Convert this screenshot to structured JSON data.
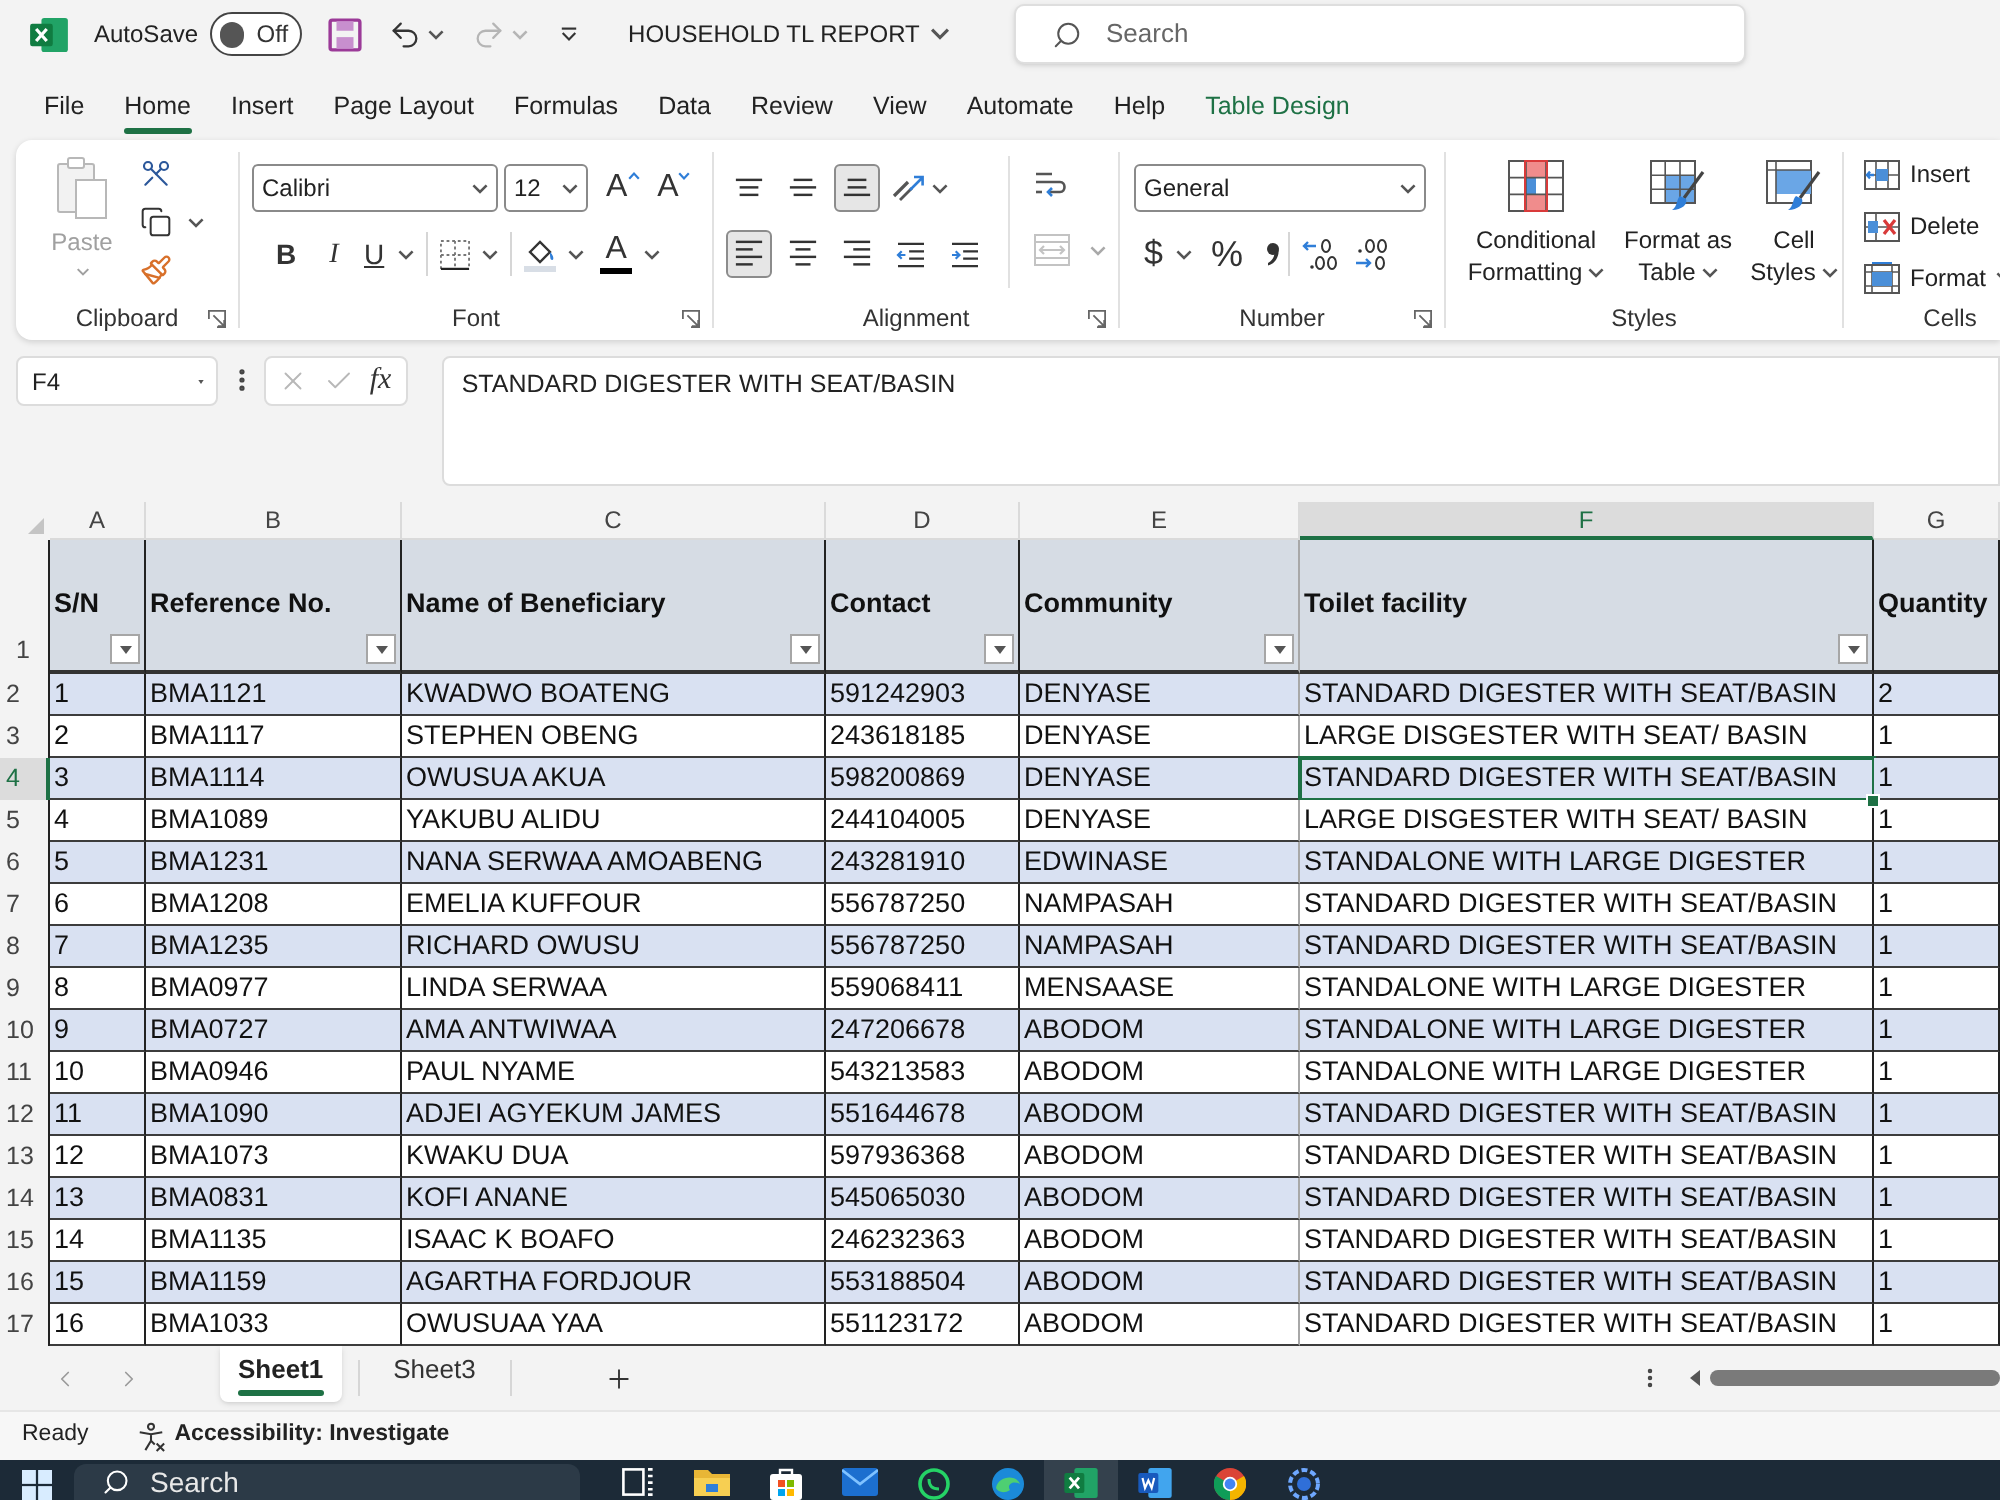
{
  "title_bar": {
    "autosave": {
      "label": "AutoSave",
      "on": false,
      "state": "Off"
    },
    "redo": {
      "disabled": true
    },
    "document_title": "HOUSEHOLD TL REPORT",
    "search": {
      "placeholder": "Search"
    }
  },
  "ribbon_tabs": [
    {
      "label": "File",
      "selected": false,
      "kind": "standard"
    },
    {
      "label": "Home",
      "selected": true,
      "kind": "standard"
    },
    {
      "label": "Insert",
      "selected": false,
      "kind": "standard"
    },
    {
      "label": "Page Layout",
      "selected": false,
      "kind": "standard"
    },
    {
      "label": "Formulas",
      "selected": false,
      "kind": "standard"
    },
    {
      "label": "Data",
      "selected": false,
      "kind": "standard"
    },
    {
      "label": "Review",
      "selected": false,
      "kind": "standard"
    },
    {
      "label": "View",
      "selected": false,
      "kind": "standard"
    },
    {
      "label": "Automate",
      "selected": false,
      "kind": "standard"
    },
    {
      "label": "Help",
      "selected": false,
      "kind": "standard"
    },
    {
      "label": "Table Design",
      "selected": false,
      "kind": "contextual"
    }
  ],
  "ribbon": {
    "clipboard": {
      "label": "Clipboard",
      "paste": {
        "label": "Paste",
        "disabled": true
      }
    },
    "font": {
      "label": "Font",
      "font_name": "Calibri",
      "font_size": "12",
      "size_buttons": [
        {
          "kind": "grow",
          "label": "A"
        },
        {
          "kind": "shrink",
          "label": "A"
        }
      ],
      "style_buttons": [
        {
          "kind": "bold",
          "label": "B"
        },
        {
          "kind": "italic",
          "label": "I"
        },
        {
          "kind": "underline",
          "label": "U"
        }
      ],
      "font_color": {
        "label": "A"
      }
    },
    "alignment": {
      "label": "Alignment",
      "vertical": [
        {
          "kind": "top",
          "selected": false
        },
        {
          "kind": "middle",
          "selected": false
        },
        {
          "kind": "bottom",
          "selected": true
        }
      ],
      "horizontal": [
        {
          "kind": "left",
          "selected": true
        },
        {
          "kind": "center",
          "selected": false
        },
        {
          "kind": "right",
          "selected": false
        }
      ],
      "merge": {
        "disabled": true
      }
    },
    "number": {
      "label": "Number",
      "format": "General",
      "currency": "$",
      "percent": "%"
    },
    "styles": {
      "label": "Styles",
      "buttons": [
        {
          "kind": "conditional",
          "lines": [
            "Conditional",
            "Formatting"
          ]
        },
        {
          "kind": "table",
          "lines": [
            "Format as",
            "Table"
          ]
        },
        {
          "kind": "cell",
          "lines": [
            "Cell",
            "Styles"
          ]
        }
      ]
    },
    "cells": {
      "label": "Cells",
      "buttons": [
        {
          "kind": "insert",
          "label": "Insert"
        },
        {
          "kind": "delete",
          "label": "Delete"
        },
        {
          "kind": "format",
          "label": "Format"
        }
      ]
    }
  },
  "formula_bar": {
    "name_box": "F4",
    "edit_buttons": [
      {
        "kind": "cancel",
        "disabled": true
      },
      {
        "kind": "enter",
        "disabled": true
      }
    ],
    "function_label": "fx",
    "formula": "STANDARD DIGESTER WITH SEAT/BASIN"
  },
  "sheet": {
    "columns": [
      {
        "letter": "A",
        "heading": "S/N",
        "selected": false
      },
      {
        "letter": "B",
        "heading": "Reference No.",
        "selected": false
      },
      {
        "letter": "C",
        "heading": "Name of Beneficiary",
        "selected": false
      },
      {
        "letter": "D",
        "heading": "Contact",
        "selected": false
      },
      {
        "letter": "E",
        "heading": "Community",
        "selected": false
      },
      {
        "letter": "F",
        "heading": "Toilet facility",
        "selected": true
      },
      {
        "letter": "G",
        "heading": "Quantity",
        "selected": false
      }
    ],
    "header_row_number": "1",
    "rows": [
      {
        "number": "2",
        "selected": false,
        "cells": [
          "1",
          "BMA1121",
          "KWADWO BOATENG",
          "591242903",
          "DENYASE",
          "STANDARD DIGESTER WITH SEAT/BASIN",
          "2"
        ]
      },
      {
        "number": "3",
        "selected": false,
        "cells": [
          "2",
          "BMA1117",
          "STEPHEN OBENG",
          "243618185",
          "DENYASE",
          "LARGE DISGESTER WITH SEAT/ BASIN",
          "1"
        ]
      },
      {
        "number": "4",
        "selected": true,
        "cells": [
          "3",
          "BMA1114",
          "OWUSUA AKUA",
          "598200869",
          "DENYASE",
          "STANDARD DIGESTER WITH SEAT/BASIN",
          "1"
        ]
      },
      {
        "number": "5",
        "selected": false,
        "cells": [
          "4",
          "BMA1089",
          "YAKUBU ALIDU",
          "244104005",
          "DENYASE",
          "LARGE DISGESTER WITH SEAT/ BASIN",
          "1"
        ]
      },
      {
        "number": "6",
        "selected": false,
        "cells": [
          "5",
          "BMA1231",
          "NANA SERWAA AMOABENG",
          "243281910",
          "EDWINASE",
          "STANDALONE WITH LARGE DIGESTER",
          "1"
        ]
      },
      {
        "number": "7",
        "selected": false,
        "cells": [
          "6",
          "BMA1208",
          "EMELIA KUFFOUR",
          "556787250",
          "NAMPASAH",
          "STANDARD DIGESTER WITH SEAT/BASIN",
          "1"
        ]
      },
      {
        "number": "8",
        "selected": false,
        "cells": [
          "7",
          "BMA1235",
          "RICHARD OWUSU",
          "556787250",
          "NAMPASAH",
          "STANDARD DIGESTER WITH SEAT/BASIN",
          "1"
        ]
      },
      {
        "number": "9",
        "selected": false,
        "cells": [
          "8",
          "BMA0977",
          "LINDA SERWAA",
          "559068411",
          "MENSAASE",
          "STANDALONE WITH LARGE DIGESTER",
          "1"
        ]
      },
      {
        "number": "10",
        "selected": false,
        "cells": [
          "9",
          "BMA0727",
          "AMA ANTWIWAA",
          "247206678",
          "ABODOM",
          "STANDALONE WITH LARGE DIGESTER",
          "1"
        ]
      },
      {
        "number": "11",
        "selected": false,
        "cells": [
          "10",
          "BMA0946",
          "PAUL NYAME",
          "543213583",
          "ABODOM",
          "STANDALONE WITH LARGE DIGESTER",
          "1"
        ]
      },
      {
        "number": "12",
        "selected": false,
        "cells": [
          "11",
          "BMA1090",
          "ADJEI AGYEKUM JAMES",
          "551644678",
          "ABODOM",
          "STANDARD DIGESTER WITH SEAT/BASIN",
          "1"
        ]
      },
      {
        "number": "13",
        "selected": false,
        "cells": [
          "12",
          "BMA1073",
          "KWAKU DUA",
          "597936368",
          "ABODOM",
          "STANDARD DIGESTER WITH SEAT/BASIN",
          "1"
        ]
      },
      {
        "number": "14",
        "selected": false,
        "cells": [
          "13",
          "BMA0831",
          "KOFI ANANE",
          "545065030",
          "ABODOM",
          "STANDARD DIGESTER WITH SEAT/BASIN",
          "1"
        ]
      },
      {
        "number": "15",
        "selected": false,
        "cells": [
          "14",
          "BMA1135",
          "ISAAC K BOAFO",
          "246232363",
          "ABODOM",
          "STANDARD DIGESTER WITH SEAT/BASIN",
          "1"
        ]
      },
      {
        "number": "16",
        "selected": false,
        "cells": [
          "15",
          "BMA1159",
          "AGARTHA FORDJOUR",
          "553188504",
          "ABODOM",
          "STANDARD DIGESTER WITH SEAT/BASIN",
          "1"
        ]
      },
      {
        "number": "17",
        "selected": false,
        "cells": [
          "16",
          "BMA1033",
          "OWUSUAA YAA",
          "551123172",
          "ABODOM",
          "STANDARD DIGESTER WITH SEAT/BASIN",
          "1"
        ]
      }
    ]
  },
  "sheet_tabs": [
    {
      "label": "Sheet1",
      "selected": true
    },
    {
      "label": "Sheet3",
      "selected": false
    }
  ],
  "status_bar": {
    "mode": "Ready",
    "accessibility": "Accessibility: Investigate"
  },
  "taskbar": {
    "search": {
      "placeholder": "Search"
    },
    "apps": [
      {
        "kind": "task_view",
        "active": false
      },
      {
        "kind": "folder",
        "active": false
      },
      {
        "kind": "store",
        "active": false
      },
      {
        "kind": "mail",
        "active": false
      },
      {
        "kind": "chat",
        "active": false
      },
      {
        "kind": "browser_wave",
        "active": false
      },
      {
        "kind": "spreadsheet",
        "active": true
      },
      {
        "kind": "document",
        "active": false
      },
      {
        "kind": "browser_ring",
        "active": false
      },
      {
        "kind": "disc",
        "active": false
      }
    ]
  }
}
